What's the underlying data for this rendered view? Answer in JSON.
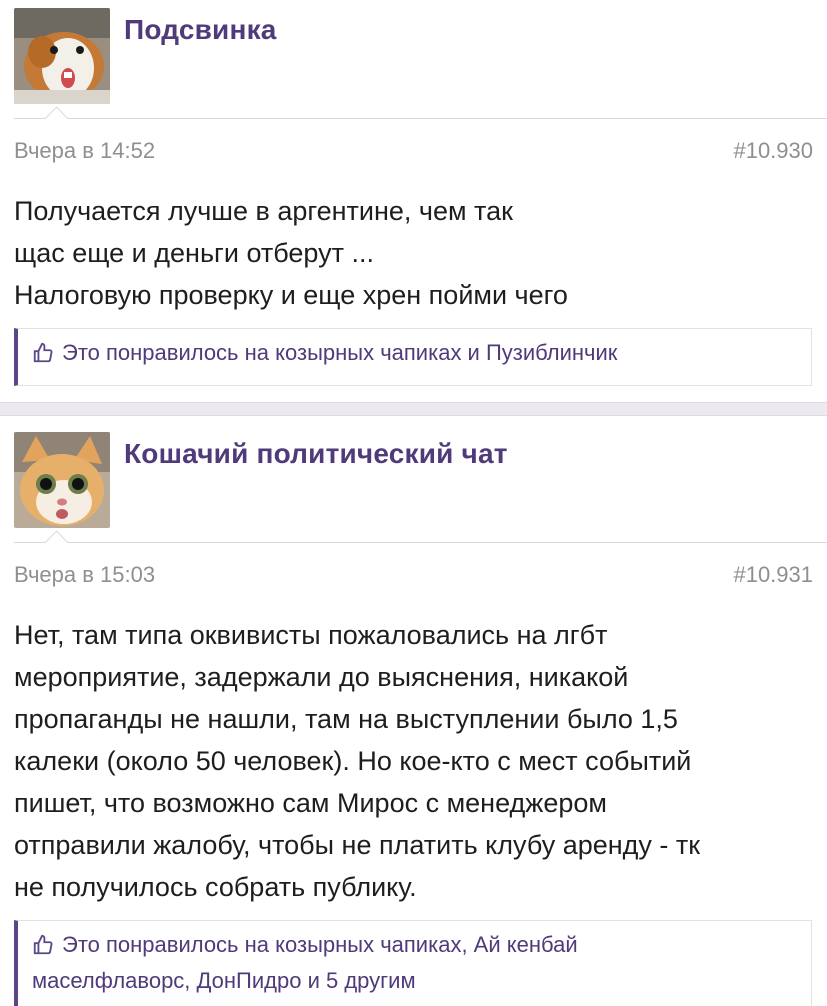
{
  "posts": [
    {
      "author": "Подсвинка",
      "avatar_icon": "guinea-pig-avatar",
      "date": "Вчера в 14:52",
      "number": "#10.930",
      "lines": [
        "Получается лучше в аргентине, чем так",
        "щас еще и деньги отберут ...",
        "Налоговую проверку и еще хрен пойми чего"
      ],
      "likes_lines": [
        "Это понравилось на козырных чапиках и Пузиблинчик"
      ]
    },
    {
      "author": "Кошачий политический чат",
      "avatar_icon": "cat-avatar",
      "date": "Вчера в 15:03",
      "number": "#10.931",
      "lines": [
        "Нет, там типа оквивисты пожаловались на лгбт",
        "мероприятие, задержали до выяснения, никакой",
        "пропаганды не нашли, там на выступлении было 1,5",
        "калеки (около 50 человек). Но кое-кто с мест событий",
        "пишет, что возможно сам Мирос с менеджером",
        "отправили жалобу, чтобы не платить клубу аренду - тк",
        "не получилось собрать публику."
      ],
      "likes_lines": [
        "Это понравилось на козырных чапиках, Ай кенбай",
        "маселфлаворс, ДонПидро и 5 другим"
      ]
    }
  ],
  "colors": {
    "author": "#4f3a7a",
    "likes_accent": "#5c4688",
    "meta": "#8f8f8f",
    "text": "#1e1e1e",
    "separator": "#eceaf0"
  }
}
